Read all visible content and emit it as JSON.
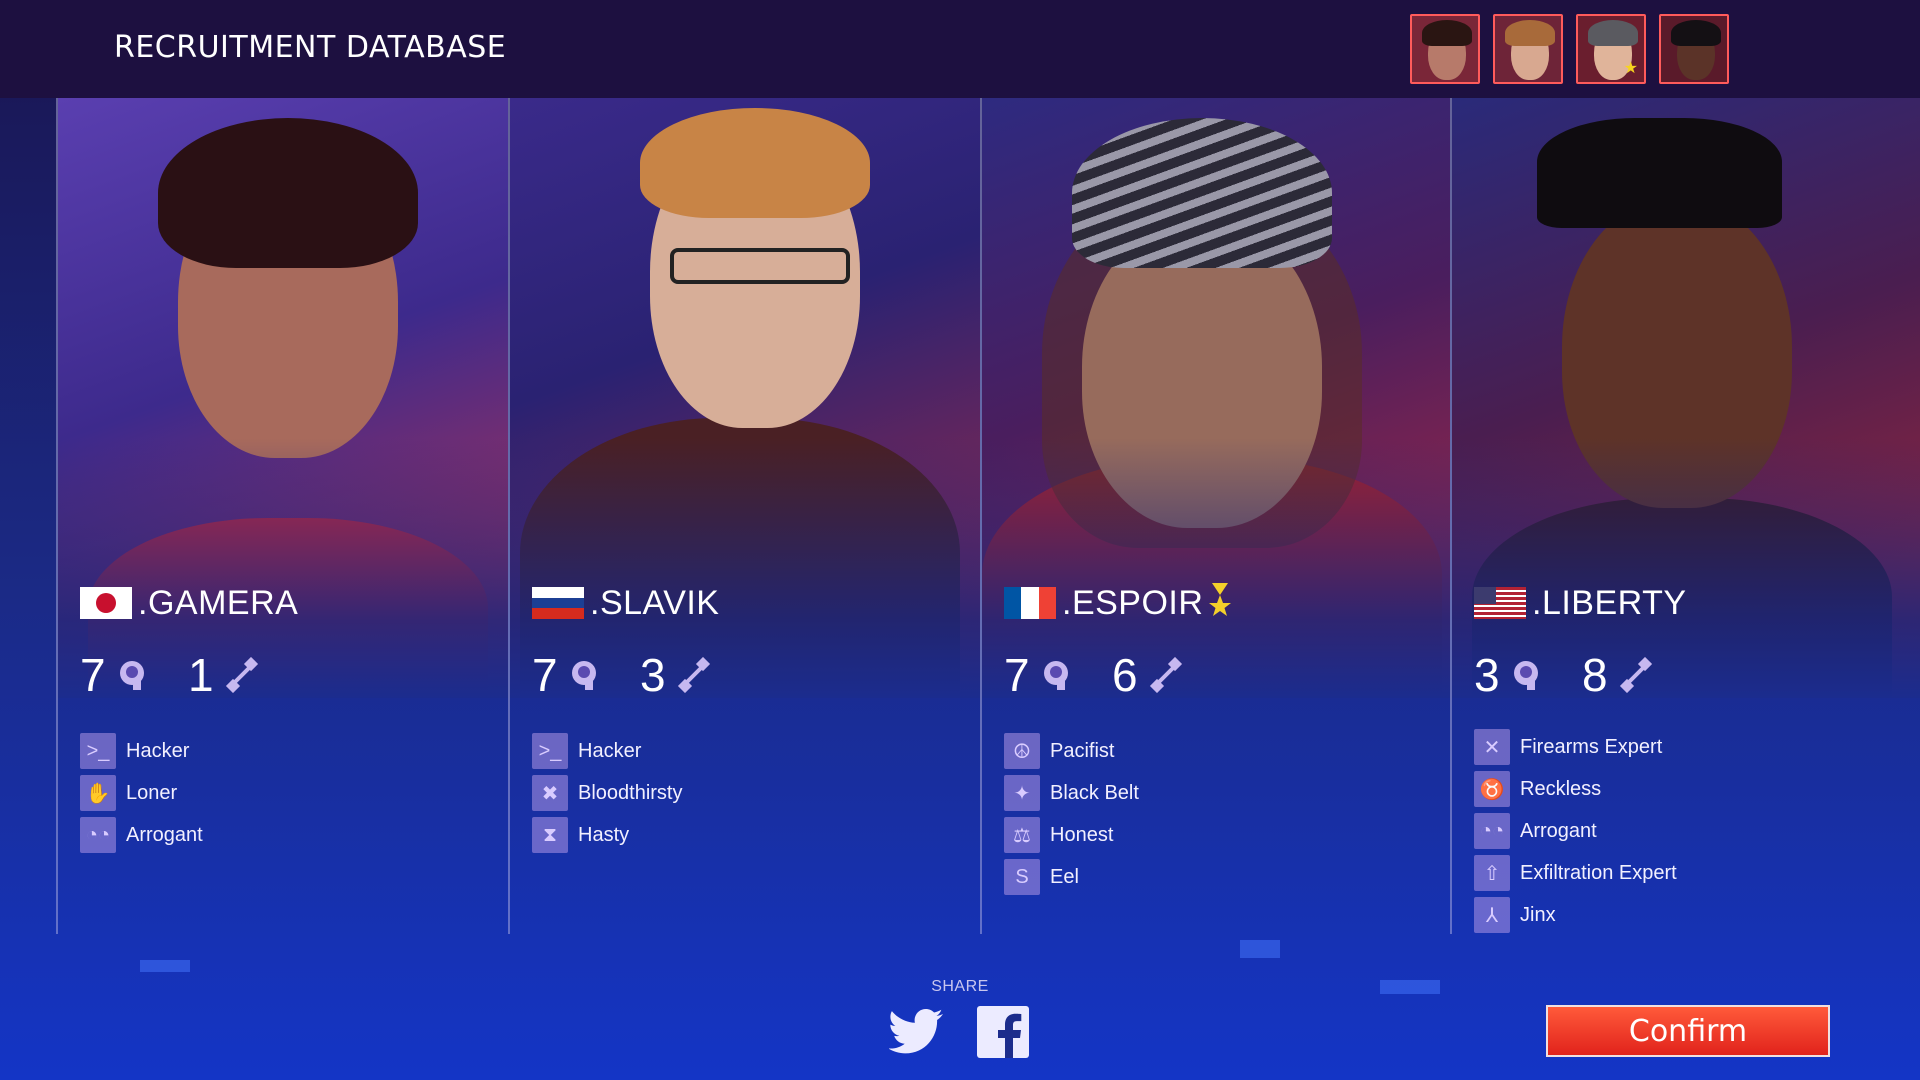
{
  "header": {
    "title": "Recruitment Database",
    "thumbnails": [
      {
        "name": "gamera",
        "skin": "#b77a6a",
        "hair": "#2a1512",
        "bg": "#7a2638"
      },
      {
        "name": "slavik",
        "skin": "#d8a890",
        "hair": "#a86a3a",
        "bg": "#6e2438"
      },
      {
        "name": "espoir",
        "skin": "#e0b49a",
        "hair": "#5a5a60",
        "bg": "#6a1e2e",
        "badge": "★"
      },
      {
        "name": "liberty",
        "skin": "#5b3328",
        "hair": "#141014",
        "bg": "#5a1a2a"
      }
    ]
  },
  "recruits": [
    {
      "name": ".GAMERA",
      "flag": "japan",
      "intellect": "7",
      "strength": "1",
      "medal": "",
      "traits": [
        {
          "label": "Hacker",
          "icon": "terminal-icon",
          "glyph": ">_"
        },
        {
          "label": "Loner",
          "icon": "loner-icon",
          "glyph": "✋"
        },
        {
          "label": "Arrogant",
          "icon": "sunglasses-icon",
          "glyph": "◔◔"
        }
      ]
    },
    {
      "name": ".SLAVIK",
      "flag": "russia",
      "intellect": "7",
      "strength": "3",
      "medal": "",
      "traits": [
        {
          "label": "Hacker",
          "icon": "terminal-icon",
          "glyph": ">_"
        },
        {
          "label": "Bloodthirsty",
          "icon": "tombstone-icon",
          "glyph": "✖"
        },
        {
          "label": "Hasty",
          "icon": "hourglass-icon",
          "glyph": "⧗"
        }
      ]
    },
    {
      "name": ".ESPOIR",
      "flag": "france",
      "intellect": "7",
      "strength": "6",
      "medal": "medal-icon",
      "traits": [
        {
          "label": "Pacifist",
          "icon": "dove-icon",
          "glyph": "☮"
        },
        {
          "label": "Black Belt",
          "icon": "martial-arts-icon",
          "glyph": "✦"
        },
        {
          "label": "Honest",
          "icon": "scales-icon",
          "glyph": "⚖"
        },
        {
          "label": "Eel",
          "icon": "eel-icon",
          "glyph": "S"
        }
      ]
    },
    {
      "name": ".LIBERTY",
      "flag": "usa",
      "intellect": "3",
      "strength": "8",
      "medal": "",
      "traits": [
        {
          "label": "Firearms Expert",
          "icon": "crossed-guns-icon",
          "glyph": "✕"
        },
        {
          "label": "Reckless",
          "icon": "bull-icon",
          "glyph": "♉"
        },
        {
          "label": "Arrogant",
          "icon": "sunglasses-icon",
          "glyph": "◔◔"
        },
        {
          "label": "Exfiltration Expert",
          "icon": "exit-arrow-icon",
          "glyph": "⇧"
        },
        {
          "label": "Jinx",
          "icon": "jinx-icon",
          "glyph": "⅄"
        }
      ]
    }
  ],
  "footer": {
    "share_label": "SHARE",
    "twitter_icon": "twitter-icon",
    "facebook_icon": "facebook-icon",
    "confirm_label": "Confirm"
  },
  "colors": {
    "confirm": "#e5341f",
    "header_bg": "#1d1040",
    "trait_icon_bg": "#9f8ad6",
    "medal": "#f4d02a"
  }
}
